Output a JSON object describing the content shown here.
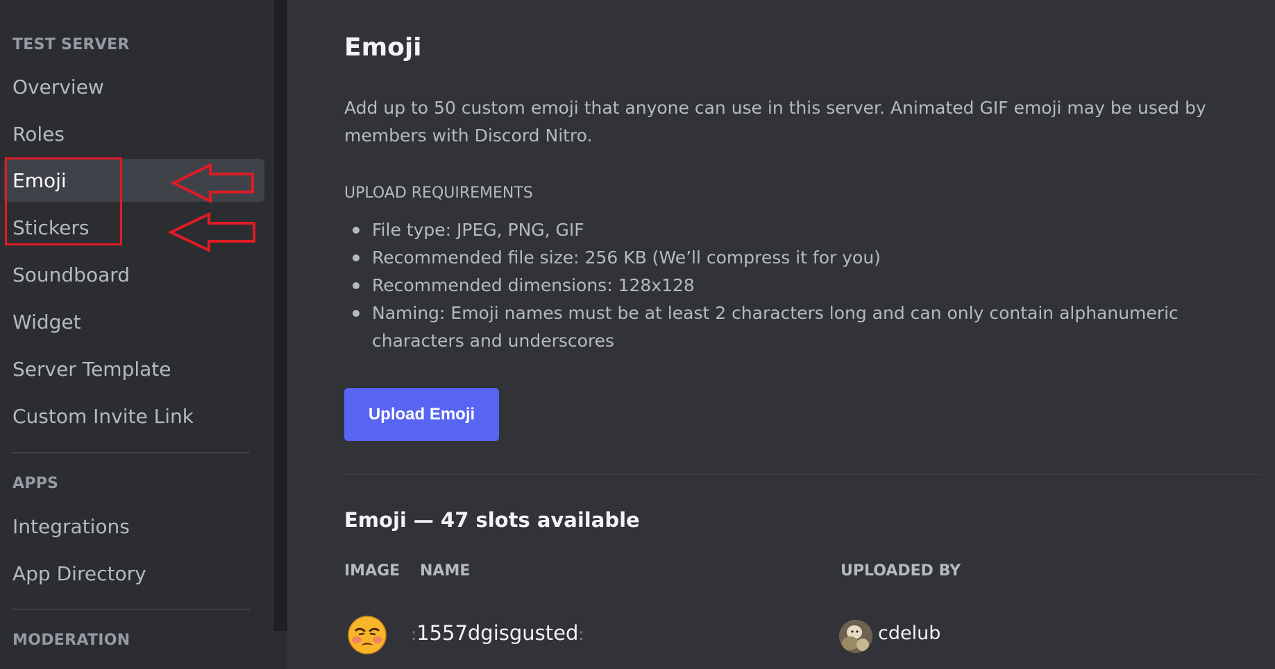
{
  "sidebar": {
    "sections": [
      {
        "header": "TEST SERVER",
        "items": [
          {
            "label": "Overview",
            "selected": false
          },
          {
            "label": "Roles",
            "selected": false
          },
          {
            "label": "Emoji",
            "selected": true
          },
          {
            "label": "Stickers",
            "selected": false
          },
          {
            "label": "Soundboard",
            "selected": false
          },
          {
            "label": "Widget",
            "selected": false
          },
          {
            "label": "Server Template",
            "selected": false
          },
          {
            "label": "Custom Invite Link",
            "selected": false
          }
        ]
      },
      {
        "header": "APPS",
        "items": [
          {
            "label": "Integrations",
            "selected": false
          },
          {
            "label": "App Directory",
            "selected": false
          }
        ]
      },
      {
        "header": "MODERATION",
        "items": []
      }
    ]
  },
  "annotations": {
    "color": "#e01b24",
    "arrows": [
      "arrow-left",
      "arrow-left"
    ]
  },
  "main": {
    "title": "Emoji",
    "description": "Add up to 50 custom emoji that anyone can use in this server. Animated GIF emoji may be used by members with Discord Nitro.",
    "requirements_header": "UPLOAD REQUIREMENTS",
    "requirements": [
      "File type: JPEG, PNG, GIF",
      "Recommended file size: 256 KB (We’ll compress it for you)",
      "Recommended dimensions: 128x128",
      "Naming: Emoji names must be at least 2 characters long and can only contain alphanumeric characters and underscores"
    ],
    "upload_button": "Upload Emoji",
    "slots_title": "Emoji — 47 slots available",
    "columns": {
      "image": "IMAGE",
      "name": "NAME",
      "uploaded_by": "UPLOADED BY"
    },
    "emoji_rows": [
      {
        "image_icon": "disgusted-face-emoji",
        "colon_left": ":",
        "name": "1557dgisgusted",
        "colon_right": ":",
        "uploader": "cdelub",
        "uploader_avatar": "user-avatar"
      }
    ]
  },
  "colors": {
    "accent": "#5865f2",
    "sidebar_bg": "#2b2d31",
    "main_bg": "#313338",
    "selected_bg": "#404249"
  }
}
